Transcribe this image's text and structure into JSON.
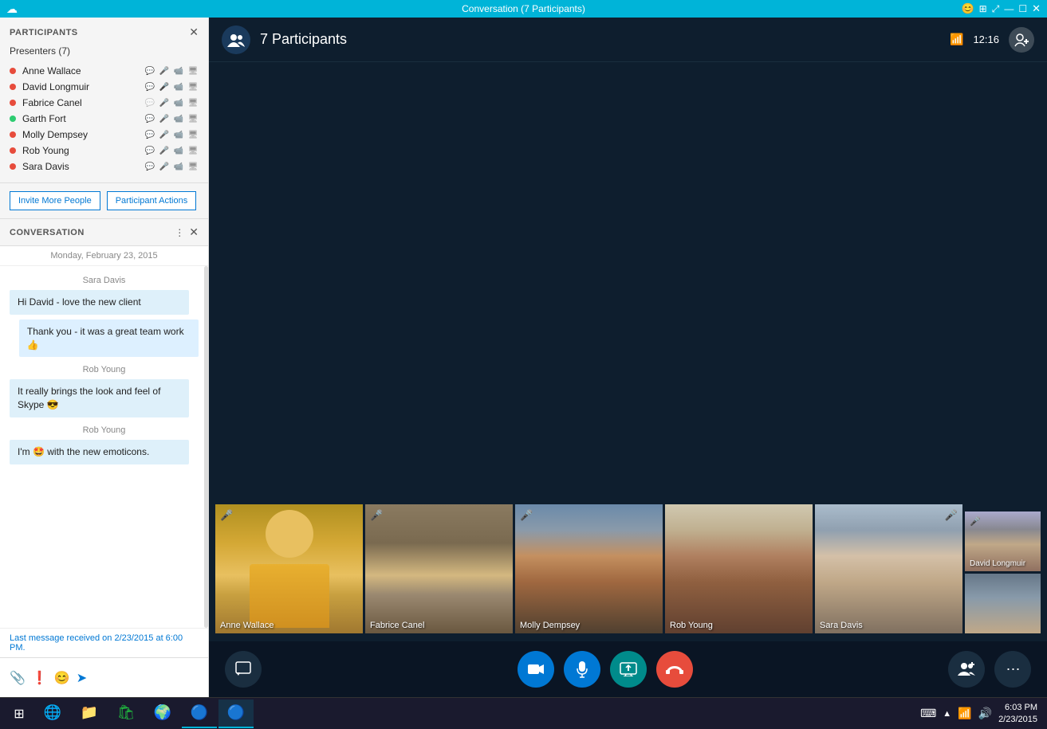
{
  "titlebar": {
    "title": "Conversation (7 Participants)",
    "skype_icon": "☁",
    "controls": [
      "😊",
      "⊞",
      "⤢",
      "—",
      "☐",
      "✕"
    ]
  },
  "participants": {
    "section_title": "PARTICIPANTS",
    "presenters_label": "Presenters (7)",
    "people": [
      {
        "name": "Anne Wallace",
        "status": "red"
      },
      {
        "name": "David Longmuir",
        "status": "red"
      },
      {
        "name": "Fabrice Canel",
        "status": "red"
      },
      {
        "name": "Garth Fort",
        "status": "green"
      },
      {
        "name": "Molly Dempsey",
        "status": "red"
      },
      {
        "name": "Rob Young",
        "status": "red"
      },
      {
        "name": "Sara Davis",
        "status": "red"
      }
    ],
    "invite_btn": "Invite More People",
    "actions_btn": "Participant Actions"
  },
  "conversation": {
    "section_title": "CONVERSATION",
    "date": "Monday, February 23, 2015",
    "messages": [
      {
        "sender": "Sara Davis",
        "text": "Hi David - love the new client",
        "own": false
      },
      {
        "sender": "",
        "text": "Thank you - it was a great team work 👍",
        "own": true
      },
      {
        "sender": "Rob Young",
        "text": "It really brings the look and feel of Skype 😎",
        "own": false
      },
      {
        "sender": "Rob Young",
        "text": "I'm 🤩 with the new emoticons.",
        "own": false
      }
    ],
    "last_message": "Last message received on 2/23/2015 at 6:00 PM."
  },
  "video": {
    "participants_count": "7 Participants",
    "time": "12:16",
    "participants": [
      {
        "name": "Anne Wallace",
        "muted": true,
        "color": "anne"
      },
      {
        "name": "Fabrice Canel",
        "muted": true,
        "color": "fabrice"
      },
      {
        "name": "Molly Dempsey",
        "muted": true,
        "color": "molly"
      },
      {
        "name": "Rob Young",
        "muted": false,
        "color": "rob"
      },
      {
        "name": "Sara Davis",
        "muted": false,
        "color": "sara"
      },
      {
        "name": "David Longmuir",
        "muted": false,
        "color": "david",
        "small": true
      }
    ]
  },
  "controls": {
    "chat_icon": "💬",
    "video_icon": "📹",
    "mic_icon": "🎤",
    "screen_icon": "🖥",
    "end_icon": "📞",
    "people_icon": "👥",
    "more_icon": "⋯"
  },
  "taskbar": {
    "start": "⊞",
    "time": "6:03 PM",
    "date": "2/23/2015",
    "apps": [
      "🌐",
      "📁",
      "🛍",
      "🌍",
      "🔵",
      "🔵"
    ]
  }
}
